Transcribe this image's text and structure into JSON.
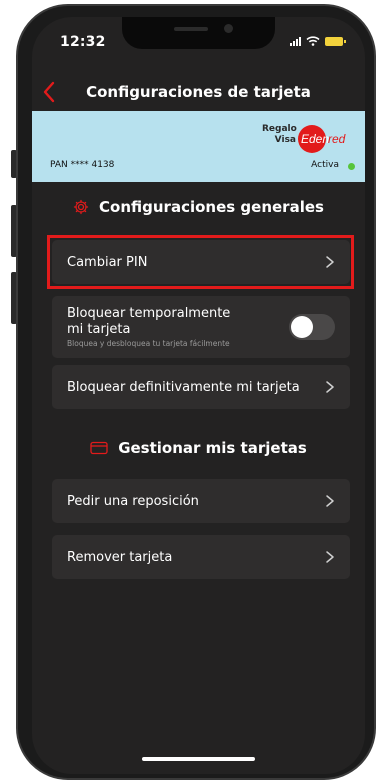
{
  "status": {
    "time": "12:32"
  },
  "nav": {
    "title": "Configuraciones de tarjeta"
  },
  "card": {
    "brand_line1": "Regalo",
    "brand_line2": "Visa",
    "issuer": "Edenred",
    "pan": "PAN **** 4138",
    "state": "Activa",
    "state_color": "#56c43a",
    "banner_color": "#b7e1ee"
  },
  "sections": {
    "general": {
      "title": "Configuraciones generales",
      "icon": "gear-icon"
    },
    "cards": {
      "title": "Gestionar mis tarjetas",
      "icon": "card-icon"
    }
  },
  "rows": {
    "change_pin": "Cambiar PIN",
    "temp_block_line1": "Bloquear temporalmente",
    "temp_block_line2": "mi tarjeta",
    "temp_block_sub": "Bloquea y desbloquea tu tarjeta fácilmente",
    "temp_block_enabled": false,
    "perm_block": "Bloquear definitivamente mi tarjeta",
    "request_replacement": "Pedir una reposición",
    "remove_card": "Remover tarjeta"
  },
  "colors": {
    "accent": "#e21b1b",
    "background": "#232222",
    "row_background": "#2f2d2d"
  }
}
